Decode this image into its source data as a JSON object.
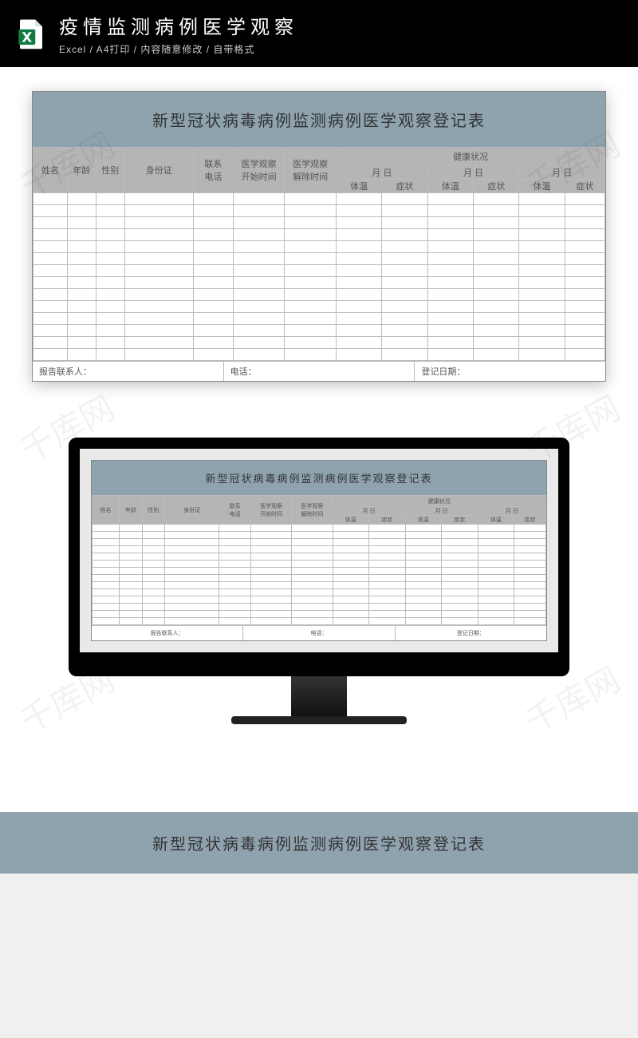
{
  "header": {
    "title": "疫情监测病例医学观察",
    "sub": "Excel / A4打印 / 内容随意修改 / 自带格式"
  },
  "sheet": {
    "title": "新型冠状病毒病例监测病例医学观察登记表",
    "cols": {
      "name": "姓名",
      "age": "年龄",
      "sex": "性别",
      "id": "身份证",
      "phone": "联系\n电话",
      "startTime": "医学观察\n开始时间",
      "endTime": "医学观察\n解除时间",
      "health": "健康状况",
      "monthDay": "月  日",
      "temp": "体温",
      "sym": "症状"
    },
    "footer": {
      "reporter": "报告联系人：",
      "phone": "电话：",
      "regDate": "登记日期："
    },
    "emptyRows": 14
  },
  "bottomStrip": "新型冠状病毒病例监测病例医学观察登记表",
  "watermark": "千库网"
}
